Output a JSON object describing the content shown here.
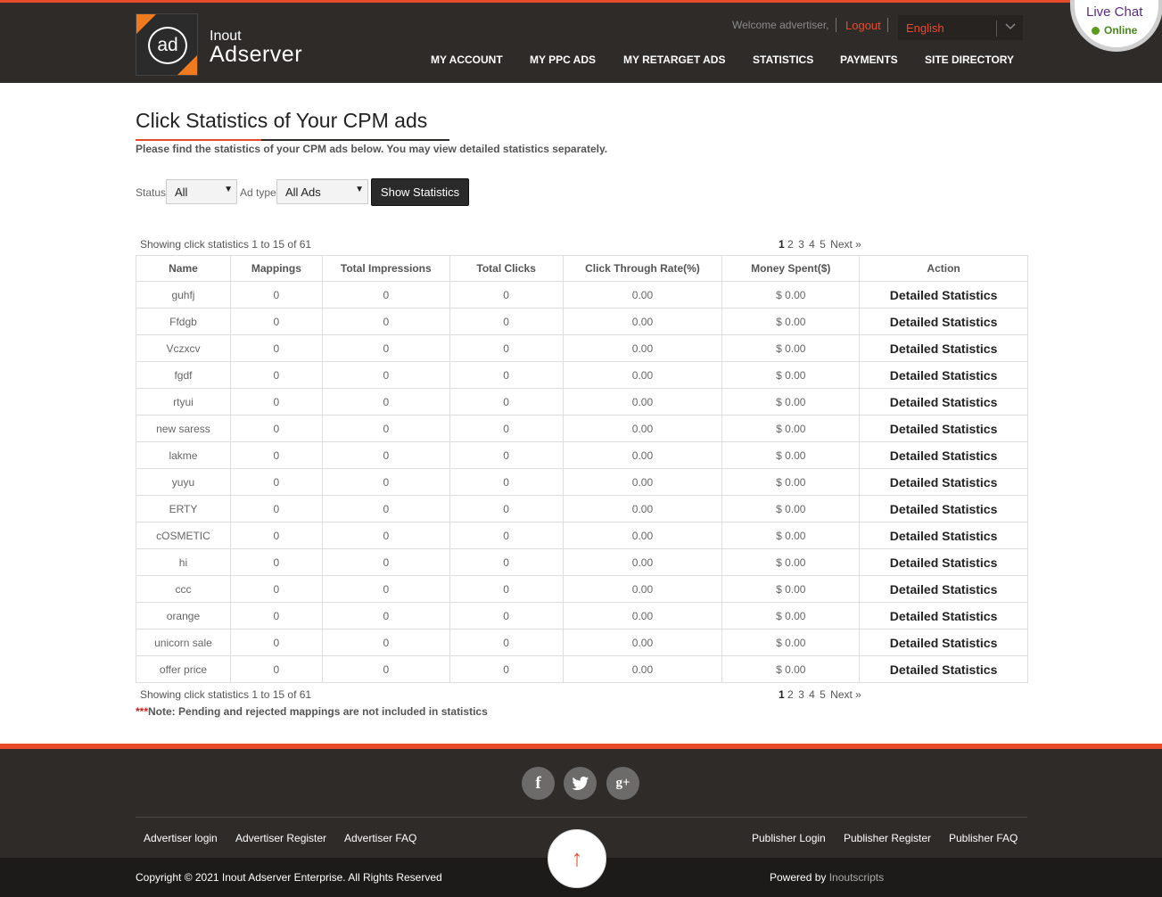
{
  "header": {
    "logo_text": "ad",
    "brand_small": "Inout",
    "brand_big": "Adserver",
    "welcome": "Welcome advertiser,",
    "logout": "Logout",
    "language": "English",
    "nav": [
      "MY ACCOUNT",
      "MY PPC ADS",
      "MY RETARGET ADS",
      "STATISTICS",
      "PAYMENTS",
      "SITE DIRECTORY"
    ]
  },
  "livechat": {
    "title": "Live Chat",
    "status": "Online"
  },
  "page": {
    "title": "Click Statistics of Your CPM ads",
    "subtitle": "Please find the statistics of your CPM ads below. You may view detailed statistics separately."
  },
  "filters": {
    "status_label": "Status",
    "status_value": "All",
    "adtype_label": "Ad type",
    "adtype_value": "All Ads",
    "show_button": "Show Statistics"
  },
  "pagination": {
    "showing": "Showing click statistics 1 to 15 of 61",
    "current": "1",
    "pages": [
      "2",
      "3",
      "4",
      "5"
    ],
    "next": "Next »"
  },
  "table": {
    "headers": [
      "Name",
      "Mappings",
      "Total Impressions",
      "Total Clicks",
      "Click Through Rate(%)",
      "Money Spent($)",
      "Action"
    ],
    "rows": [
      {
        "name": "guhfj",
        "mappings": "0",
        "impressions": "0",
        "clicks": "0",
        "ctr": "0.00",
        "money": "$ 0.00",
        "action": "Detailed Statistics"
      },
      {
        "name": "Ffdgb",
        "mappings": "0",
        "impressions": "0",
        "clicks": "0",
        "ctr": "0.00",
        "money": "$ 0.00",
        "action": "Detailed Statistics"
      },
      {
        "name": "Vczxcv",
        "mappings": "0",
        "impressions": "0",
        "clicks": "0",
        "ctr": "0.00",
        "money": "$ 0.00",
        "action": "Detailed Statistics"
      },
      {
        "name": "fgdf",
        "mappings": "0",
        "impressions": "0",
        "clicks": "0",
        "ctr": "0.00",
        "money": "$ 0.00",
        "action": "Detailed Statistics"
      },
      {
        "name": "rtyui",
        "mappings": "0",
        "impressions": "0",
        "clicks": "0",
        "ctr": "0.00",
        "money": "$ 0.00",
        "action": "Detailed Statistics"
      },
      {
        "name": "new saress",
        "mappings": "0",
        "impressions": "0",
        "clicks": "0",
        "ctr": "0.00",
        "money": "$ 0.00",
        "action": "Detailed Statistics"
      },
      {
        "name": "lakme",
        "mappings": "0",
        "impressions": "0",
        "clicks": "0",
        "ctr": "0.00",
        "money": "$ 0.00",
        "action": "Detailed Statistics"
      },
      {
        "name": "yuyu",
        "mappings": "0",
        "impressions": "0",
        "clicks": "0",
        "ctr": "0.00",
        "money": "$ 0.00",
        "action": "Detailed Statistics"
      },
      {
        "name": "ERTY",
        "mappings": "0",
        "impressions": "0",
        "clicks": "0",
        "ctr": "0.00",
        "money": "$ 0.00",
        "action": "Detailed Statistics"
      },
      {
        "name": "cOSMETIC",
        "mappings": "0",
        "impressions": "0",
        "clicks": "0",
        "ctr": "0.00",
        "money": "$ 0.00",
        "action": "Detailed Statistics"
      },
      {
        "name": "hi",
        "mappings": "0",
        "impressions": "0",
        "clicks": "0",
        "ctr": "0.00",
        "money": "$ 0.00",
        "action": "Detailed Statistics"
      },
      {
        "name": "ccc",
        "mappings": "0",
        "impressions": "0",
        "clicks": "0",
        "ctr": "0.00",
        "money": "$ 0.00",
        "action": "Detailed Statistics"
      },
      {
        "name": "orange",
        "mappings": "0",
        "impressions": "0",
        "clicks": "0",
        "ctr": "0.00",
        "money": "$ 0.00",
        "action": "Detailed Statistics"
      },
      {
        "name": "unicorn sale",
        "mappings": "0",
        "impressions": "0",
        "clicks": "0",
        "ctr": "0.00",
        "money": "$ 0.00",
        "action": "Detailed Statistics"
      },
      {
        "name": "offer price",
        "mappings": "0",
        "impressions": "0",
        "clicks": "0",
        "ctr": "0.00",
        "money": "$ 0.00",
        "action": "Detailed Statistics"
      }
    ]
  },
  "note": {
    "stars": "***",
    "text": "Note: Pending and rejected mappings are not included in statistics"
  },
  "footer": {
    "social": [
      {
        "icon": "facebook-icon",
        "glyph": "f"
      },
      {
        "icon": "twitter-icon",
        "glyph": "🐦"
      },
      {
        "icon": "google-plus-icon",
        "glyph": "g+"
      }
    ],
    "left_links": [
      "Advertiser login",
      "Advertiser Register",
      "Advertiser FAQ"
    ],
    "right_links": [
      "Publisher Login",
      "Publisher Register",
      "Publisher FAQ"
    ],
    "copyright": "Copyright © 2021 Inout Adserver Enterprise. All Rights Reserved",
    "powered_label": "Powered by",
    "powered_link": "Inoutscripts",
    "up_arrow": "↑"
  },
  "colors": {
    "accent": "#e84b2c",
    "header_bg": "#2e2b29",
    "logo_orange": "#f07a1e"
  }
}
